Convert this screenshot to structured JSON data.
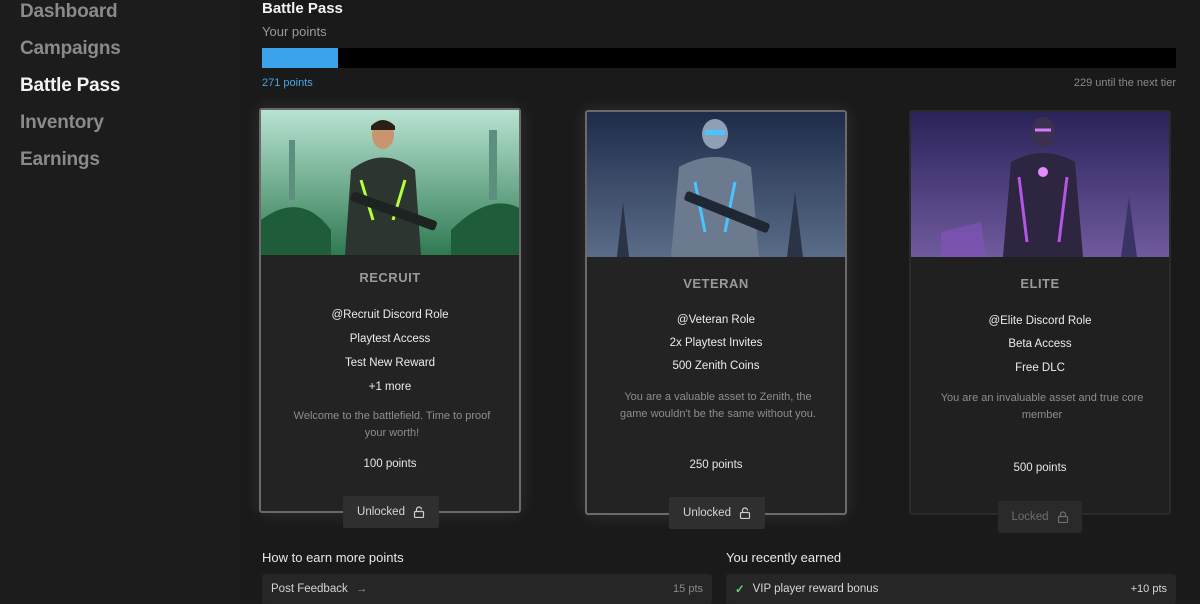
{
  "sidebar": {
    "items": [
      {
        "label": "Dashboard"
      },
      {
        "label": "Campaigns"
      },
      {
        "label": "Battle Pass"
      },
      {
        "label": "Inventory"
      },
      {
        "label": "Earnings"
      }
    ]
  },
  "header": {
    "title": "Battle Pass",
    "subtitle": "Your points"
  },
  "progress": {
    "fraction": 0.0835,
    "points_label": "271 points",
    "next_tier_label": "229 until the next tier",
    "color": "#3aa3ea"
  },
  "tiers": [
    {
      "name": "RECRUIT",
      "rewards": [
        "@Recruit Discord Role",
        "Playtest Access",
        "Test New Reward",
        "+1 more"
      ],
      "description": "Welcome to the battlefield. Time to proof your worth!",
      "cost": "100 points",
      "status": "Unlocked"
    },
    {
      "name": "VETERAN",
      "rewards": [
        "@Veteran Role",
        "2x Playtest Invites",
        "500 Zenith Coins"
      ],
      "description": "You are a valuable asset to Zenith, the game wouldn't be the same without you.",
      "cost": "250 points",
      "status": "Unlocked"
    },
    {
      "name": "ELITE",
      "rewards": [
        "@Elite Discord Role",
        "Beta Access",
        "Free DLC"
      ],
      "description": "You are an invaluable asset and true core member",
      "cost": "500 points",
      "status": "Locked"
    }
  ],
  "earn_more": {
    "title": "How to earn more points",
    "items": [
      {
        "label": "Post Feedback",
        "points": "15 pts"
      }
    ]
  },
  "recent": {
    "title": "You recently earned",
    "items": [
      {
        "label": "VIP player reward bonus",
        "points": "+10 pts"
      }
    ]
  }
}
